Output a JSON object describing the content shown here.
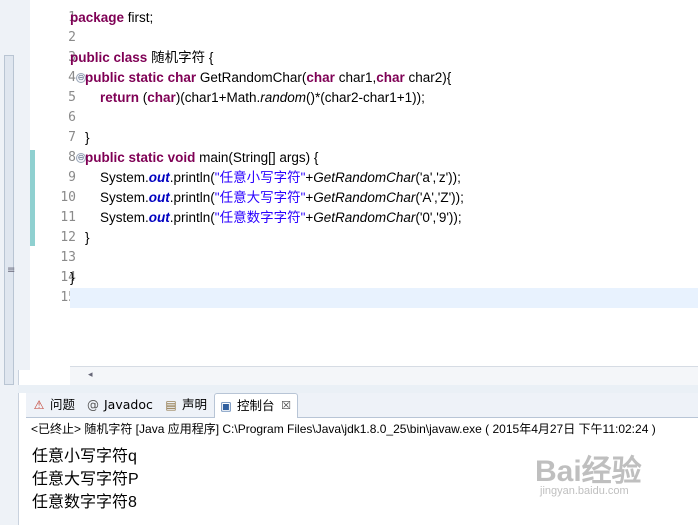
{
  "editor": {
    "line_numbers": [
      "1",
      "2",
      "3",
      "4",
      "5",
      "6",
      "7",
      "8",
      "9",
      "10",
      "11",
      "12",
      "13",
      "14",
      "15"
    ],
    "folds": [
      "⊖",
      "⊖"
    ],
    "line1_kw": "package",
    "line1_rest": " first;",
    "line3_kw1": "public",
    "line3_kw2": "class",
    "line3_rest": " 随机字符 {",
    "line4_kw1": "public",
    "line4_kw2": "static",
    "line4_kw3": "char",
    "line4_mid": " GetRandomChar(",
    "line4_kw4": "char",
    "line4_p1": " char1,",
    "line4_kw5": "char",
    "line4_p2": " char2){",
    "line5_kw1": "return",
    "line5_a": " (",
    "line5_kw2": "char",
    "line5_b": ")(char1+Math.",
    "line5_c": "random",
    "line5_d": "()*(char2-char1+1));",
    "line7": "}",
    "line8_kw1": "public",
    "line8_kw2": "static",
    "line8_kw3": "void",
    "line8_rest": " main(String[] args) {",
    "sys": "System.",
    "out": "out",
    "println": ".println(",
    "grc": "GetRandomChar",
    "line9_str": "\"任意小写字符\"",
    "line9_args": "('a','z'));",
    "line10_str": "\"任意大写字符\"",
    "line10_args": "('A','Z'));",
    "line11_str": "\"任意数字字符\"",
    "line11_args": "('0','9'));",
    "line12": "}",
    "line14": "}",
    "plus": "+"
  },
  "tabs": {
    "problems": "问题",
    "javadoc": "Javadoc",
    "declaration": "声明",
    "console": "控制台",
    "close": "☒",
    "problems_icon": "⚠",
    "javadoc_icon": "@",
    "declaration_icon": "▤",
    "console_icon": "▣"
  },
  "console": {
    "header": "<已终止> 随机字符 [Java 应用程序] C:\\Program Files\\Java\\jdk1.8.0_25\\bin\\javaw.exe ( 2015年4月27日 下午11:02:24 )",
    "lines": [
      "任意小写字符q",
      "任意大写字符P",
      "任意数字字符8"
    ]
  },
  "watermark": {
    "brand": "Bai经验",
    "url": "jingyan.baidu.com"
  },
  "colors": {
    "keyword": "#7f0055",
    "string": "#2a00ff",
    "static_field": "#0000c0",
    "current_line": "#e8f2fe",
    "change_bar": "#8fd0d0"
  }
}
